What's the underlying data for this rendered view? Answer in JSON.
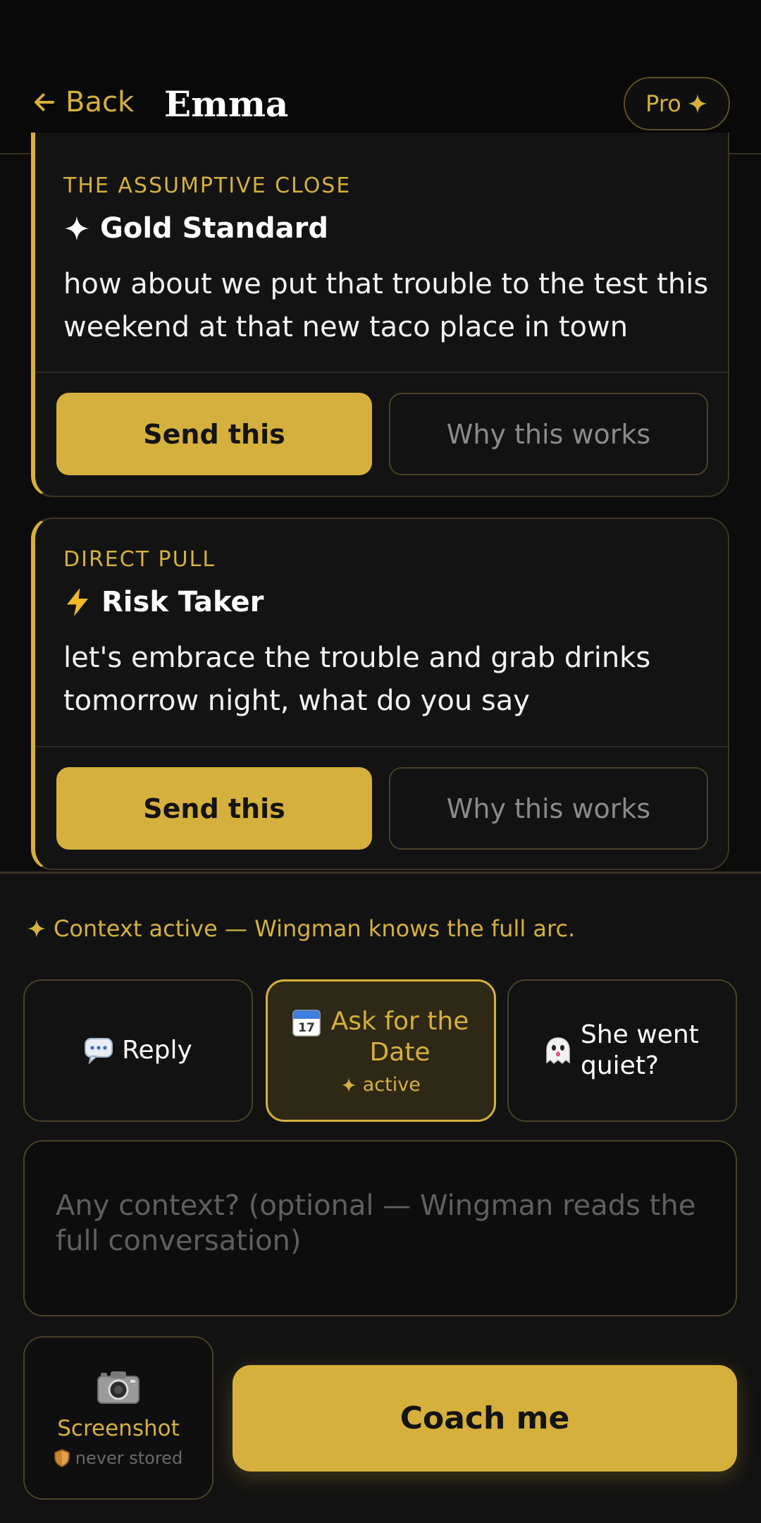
{
  "header": {
    "back_label": "Back",
    "title": "Emma",
    "pro_label": "Pro"
  },
  "cards": [
    {
      "category": "THE ASSUMPTIVE CLOSE",
      "icon": "sparkle-icon",
      "name": "Gold Standard",
      "text": "how about we put that trouble to the test this weekend at that new taco place in town",
      "send_label": "Send this",
      "why_label": "Why this works"
    },
    {
      "category": "DIRECT PULL",
      "icon": "lightning-icon",
      "name": "Risk Taker",
      "text": "let's embrace the trouble and grab drinks tomorrow night, what do you say",
      "send_label": "Send this",
      "why_label": "Why this works"
    }
  ],
  "panel": {
    "context_note": "Context active — Wingman knows the full arc.",
    "chips": [
      {
        "icon": "speech-bubble-icon",
        "label": "Reply",
        "sub": ""
      },
      {
        "icon": "calendar-icon",
        "label": "Ask for the Date",
        "sub": "active"
      },
      {
        "icon": "ghost-icon",
        "label": "She went quiet?",
        "sub": ""
      }
    ],
    "context_placeholder": "Any context? (optional — Wingman reads the full conversation)",
    "screenshot_label": "Screenshot",
    "screenshot_sub": "never stored",
    "coach_label": "Coach me"
  },
  "colors": {
    "accent": "#d5b03c",
    "background": "#0c0c0c",
    "card": "#131313"
  }
}
